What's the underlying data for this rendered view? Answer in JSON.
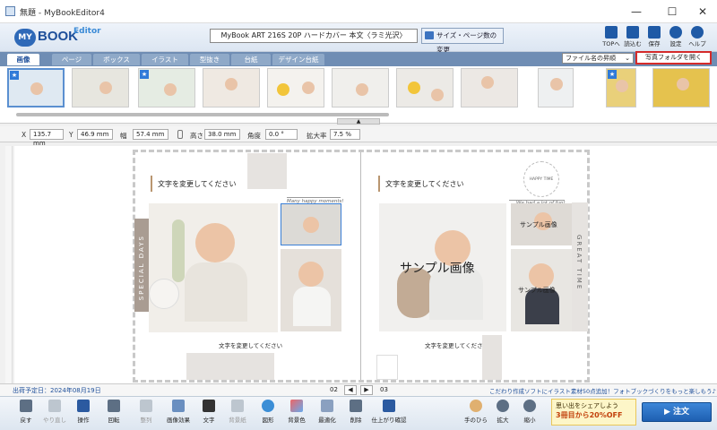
{
  "window": {
    "title": "無題 - MyBookEditor4",
    "controls": [
      "—",
      "☐",
      "✕"
    ]
  },
  "logo": {
    "my": "MY",
    "book": "BOOK",
    "editor": "Editor"
  },
  "header": {
    "product_title": "MyBook ART 216S 20P ハードカバー 本文〈ラミ光沢〉",
    "size_button": "サイズ・ページ数の変更",
    "tools": [
      {
        "label": "TOPへ",
        "icon": "home-icon"
      },
      {
        "label": "読込む",
        "icon": "open-icon"
      },
      {
        "label": "保存",
        "icon": "save-icon"
      },
      {
        "label": "設定",
        "icon": "gear-icon"
      },
      {
        "label": "ヘルプ",
        "icon": "help-icon"
      }
    ]
  },
  "tabs": [
    "画像",
    "ページ",
    "ボックス",
    "イラスト",
    "型抜き",
    "台紙",
    "デザイン台紙"
  ],
  "active_tab": "画像",
  "sort_select": "ファイル名の昇順",
  "open_folder_button": "写真フォルダを開く",
  "properties": {
    "x_label": "X",
    "x_value": "135.7 mm",
    "y_label": "Y",
    "y_value": "46.9 mm",
    "w_label": "幅",
    "w_value": "57.4 mm",
    "h_label": "高さ",
    "h_value": "38.0 mm",
    "angle_label": "角度",
    "angle_value": "0.0 °",
    "scale_label": "拡大率",
    "scale_value": "7.5 %"
  },
  "left_page": {
    "title_placeholder": "文字を変更してください",
    "script_caption": "Many happy moments!",
    "side_text": "SPECIAL DAYS",
    "bottom_caption": "文字を変更してください"
  },
  "right_page": {
    "title_placeholder": "文字を変更してください",
    "script_caption": "We had a lot of fun!",
    "side_text": "GREAT TIME",
    "sample_label_large": "サンプル画像",
    "sample_label_small_1": "サンプル画像",
    "sample_label_small_2": "サンプル画像",
    "bottom_caption": "文字を変更してください",
    "badge": "HAPPY TIME"
  },
  "status": {
    "ship_date": "出荷予定日：2024年08月19日",
    "page_left": "02",
    "page_right": "03",
    "promo_line": "こだわり作成ソフトにイラスト素材50点追加！フォトブックづくりをもっと楽しもう♪"
  },
  "bottom_toolbar": [
    {
      "label": "戻す",
      "icon": "undo-icon",
      "enabled": true
    },
    {
      "label": "やり直し",
      "icon": "redo-icon",
      "enabled": false
    },
    {
      "label": "操作",
      "icon": "pointer-icon",
      "enabled": true
    },
    {
      "label": "回転",
      "icon": "rotate-icon",
      "enabled": true
    },
    {
      "label": "整列",
      "icon": "align-icon",
      "enabled": false
    },
    {
      "label": "画像効果",
      "icon": "effect-icon",
      "enabled": true
    },
    {
      "label": "文字",
      "icon": "text-icon",
      "enabled": true
    },
    {
      "label": "背景紙",
      "icon": "paper-icon",
      "enabled": false
    },
    {
      "label": "図形",
      "icon": "shape-icon",
      "enabled": true
    },
    {
      "label": "背景色",
      "icon": "bgcolor-icon",
      "enabled": true
    },
    {
      "label": "最適化",
      "icon": "optimize-icon",
      "enabled": true
    },
    {
      "label": "削除",
      "icon": "trash-icon",
      "enabled": true
    },
    {
      "label": "仕上がり確認",
      "icon": "preview-icon",
      "enabled": true
    },
    {
      "label": "手のひら",
      "icon": "hand-icon",
      "enabled": true
    },
    {
      "label": "拡大",
      "icon": "zoom-in-icon",
      "enabled": true
    },
    {
      "label": "縮小",
      "icon": "zoom-out-icon",
      "enabled": true
    }
  ],
  "promo_box": {
    "line1": "思い出をシェアしよう",
    "line2": "3冊目から20%OFF"
  },
  "order_button": "注文",
  "colors": {
    "accent": "#1e5fb1",
    "highlight_border": "#d42a2a",
    "tab_bar": "#6f8db4"
  }
}
